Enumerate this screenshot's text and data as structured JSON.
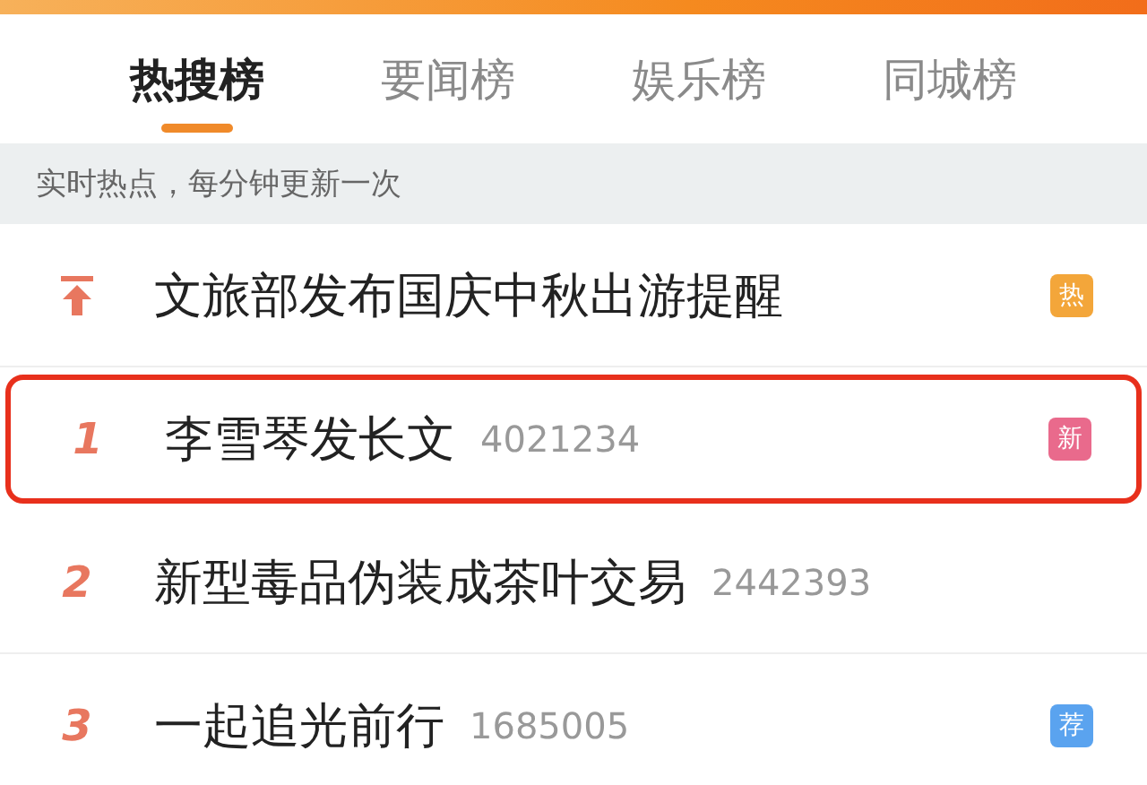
{
  "tabs": [
    {
      "label": "热搜榜",
      "selected": true
    },
    {
      "label": "要闻榜",
      "selected": false
    },
    {
      "label": "娱乐榜",
      "selected": false
    },
    {
      "label": "同城榜",
      "selected": false
    }
  ],
  "notice": "实时热点，每分钟更新一次",
  "items": [
    {
      "kind": "pinned",
      "title": "文旅部发布国庆中秋出游提醒",
      "badge": "热",
      "color": "#f3a63a",
      "highlighted": false
    },
    {
      "kind": "ranked",
      "rank": "1",
      "title": "李雪琴发长文",
      "count": "4021234",
      "badge": "新",
      "color": "#e96a8c",
      "highlighted": true
    },
    {
      "kind": "ranked",
      "rank": "2",
      "title": "新型毒品伪装成茶叶交易",
      "count": "2442393",
      "highlighted": false
    },
    {
      "kind": "ranked",
      "rank": "3",
      "title": "一起追光前行",
      "count": "1685005",
      "badge": "荐",
      "color": "#5aa3ef",
      "highlighted": false
    }
  ]
}
